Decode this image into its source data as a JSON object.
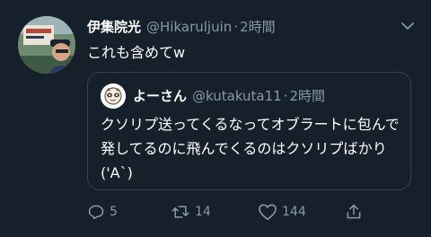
{
  "tweet": {
    "display_name": "伊集院光",
    "handle": "@Hikaruljuin",
    "separator": "·",
    "time": "2時間",
    "text": "これも含めてw"
  },
  "quoted_tweet": {
    "display_name": "よーさん",
    "handle": "@kutakuta11",
    "separator": "·",
    "time": "2時間",
    "text": "クソリプ送ってくるなってオブラートに包んで発してるのに飛んでくるのはクソリプばかり('A`)"
  },
  "actions": {
    "reply_count": "5",
    "retweet_count": "14",
    "like_count": "144"
  },
  "icons": {
    "more": "chevron-down-icon",
    "reply": "reply-icon",
    "retweet": "retweet-icon",
    "like": "heart-icon",
    "share": "share-icon"
  },
  "colors": {
    "background": "#15202b",
    "secondary_text": "#8899a6",
    "border": "#38444d"
  }
}
